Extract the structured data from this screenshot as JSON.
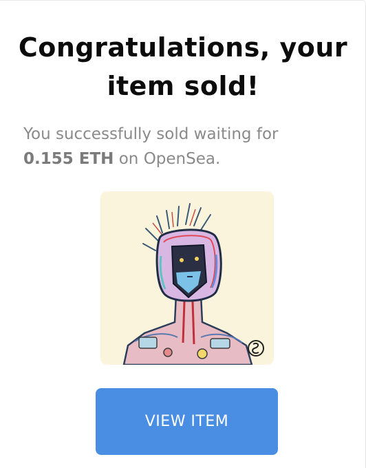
{
  "dialog": {
    "title_line1": "Congratulations, your",
    "title_line2": "item sold!",
    "message_prefix": "You successfully sold waiting for",
    "amount": "0.155 ETH",
    "message_suffix": "on OpenSea.",
    "artwork_icon": "nft-robot-portrait",
    "button_label": "VIEW ITEM"
  },
  "colors": {
    "button_bg": "#4a8ee3",
    "title_text": "#0b0b0b",
    "message_text": "#8a8a8a",
    "artwork_bg": "#fbf4dc"
  }
}
